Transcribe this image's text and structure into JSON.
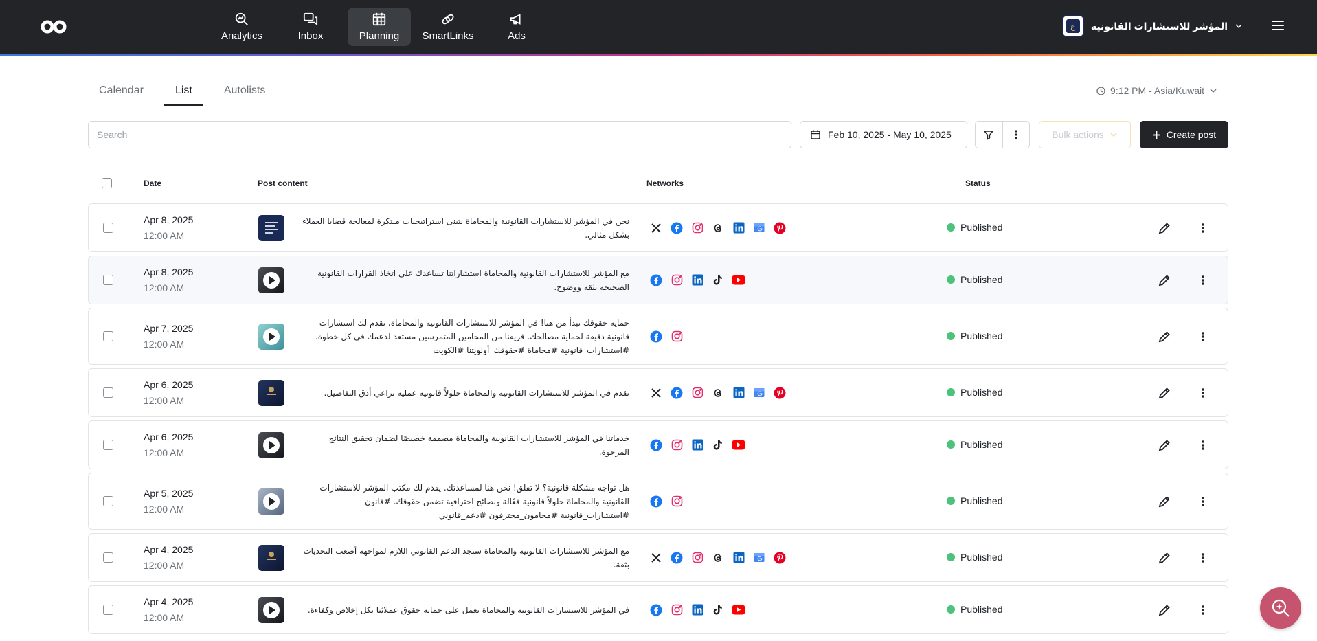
{
  "nav": {
    "items": [
      {
        "label": "Analytics",
        "icon": "analytics-icon"
      },
      {
        "label": "Inbox",
        "icon": "inbox-icon"
      },
      {
        "label": "Planning",
        "icon": "calendar-icon",
        "active": true
      },
      {
        "label": "SmartLinks",
        "icon": "link-icon"
      },
      {
        "label": "Ads",
        "icon": "megaphone-icon"
      }
    ]
  },
  "account": {
    "name": "المؤشر للاستشارات القانونية",
    "avatar_text": "ع"
  },
  "tabs": [
    {
      "label": "Calendar"
    },
    {
      "label": "List",
      "active": true
    },
    {
      "label": "Autolists"
    }
  ],
  "timezone": {
    "label": "9:12 PM - Asia/Kuwait"
  },
  "toolbar": {
    "search_placeholder": "Search",
    "date_range": "Feb 10, 2025 - May 10, 2025",
    "bulk_label": "Bulk actions",
    "create_label": "Create post"
  },
  "table": {
    "headers": {
      "date": "Date",
      "content": "Post content",
      "networks": "Networks",
      "status": "Status"
    },
    "rows": [
      {
        "date": "Apr 8, 2025",
        "time": "12:00 AM",
        "thumb": "doc",
        "content": "نحن في المؤشر للاستشارات القانونية والمحاماة نتبنى استراتيجيات مبتكرة لمعالجة قضايا العملاء بشكل مثالي.",
        "networks": [
          "x",
          "facebook",
          "instagram",
          "threads",
          "linkedin",
          "gmb",
          "pinterest"
        ],
        "status": "Published"
      },
      {
        "date": "Apr 8, 2025",
        "time": "12:00 AM",
        "thumb": "video-dark",
        "content": "مع المؤشر للاستشارات القانونية والمحاماة استشاراتنا تساعدك على اتخاذ القرارات القانونية الصحيحة بثقة ووضوح.",
        "networks": [
          "facebook",
          "instagram",
          "linkedin",
          "tiktok",
          "youtube"
        ],
        "status": "Published",
        "highlight": true
      },
      {
        "date": "Apr 7, 2025",
        "time": "12:00 AM",
        "thumb": "video-teal",
        "content": "حماية حقوقك تبدأ من هنا! في المؤشر للاستشارات القانونية والمحاماة، نقدم لك استشارات قانونية دقيقة لحماية مصالحك. فريقنا من المحامين المتمرسين مستعد لدعمك في كل خطوة. #استشارات_قانونية #محاماة #حقوقك_أولويتنا #الكويت",
        "networks": [
          "facebook",
          "instagram"
        ],
        "status": "Published"
      },
      {
        "date": "Apr 6, 2025",
        "time": "12:00 AM",
        "thumb": "navy",
        "content": "نقدم في المؤشر للاستشارات القانونية والمحاماة حلولاً قانونية عملية تراعي أدق التفاصيل.",
        "networks": [
          "x",
          "facebook",
          "instagram",
          "threads",
          "linkedin",
          "gmb",
          "pinterest"
        ],
        "status": "Published"
      },
      {
        "date": "Apr 6, 2025",
        "time": "12:00 AM",
        "thumb": "video-dark",
        "content": "خدماتنا في المؤشر للاستشارات القانونية والمحاماة مصممة خصيصًا لضمان تحقيق النتائج المرجوة.",
        "networks": [
          "facebook",
          "instagram",
          "linkedin",
          "tiktok",
          "youtube"
        ],
        "status": "Published"
      },
      {
        "date": "Apr 5, 2025",
        "time": "12:00 AM",
        "thumb": "video-grey",
        "content": "هل تواجه مشكلة قانونية؟ لا تقلق! نحن هنا لمساعدتك. يقدم لك مكتب المؤشر للاستشارات القانونية والمحاماة حلولاً قانونية فعّالة ونصائح احترافية تضمن حقوقك. #قانون #استشارات_قانونية #محامون_محترفون #دعم_قانوني",
        "networks": [
          "facebook",
          "instagram"
        ],
        "status": "Published"
      },
      {
        "date": "Apr 4, 2025",
        "time": "12:00 AM",
        "thumb": "navy",
        "content": "مع المؤشر للاستشارات القانونية والمحاماة ستجد الدعم القانوني اللازم لمواجهة أصعب التحديات بثقة.",
        "networks": [
          "x",
          "facebook",
          "instagram",
          "threads",
          "linkedin",
          "gmb",
          "pinterest"
        ],
        "status": "Published"
      },
      {
        "date": "Apr 4, 2025",
        "time": "12:00 AM",
        "thumb": "video-dark",
        "content": "في المؤشر للاستشارات القانونية والمحاماة نعمل على حماية حقوق عملائنا بكل إخلاص وكفاءة.",
        "networks": [
          "facebook",
          "instagram",
          "linkedin",
          "tiktok",
          "youtube"
        ],
        "status": "Published"
      }
    ]
  },
  "colors": {
    "topbar": "#222427",
    "published": "#4cc27b",
    "fab": "#c7546f"
  }
}
